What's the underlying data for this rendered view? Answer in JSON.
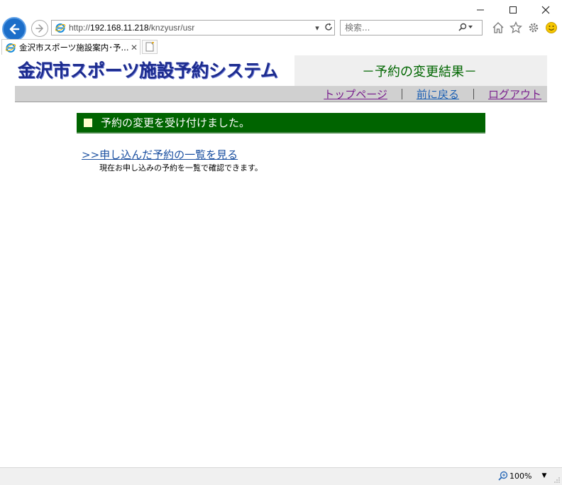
{
  "browser": {
    "address": {
      "prefix": "http://",
      "host": "192.168.11.218",
      "path": "/knzyusr/usr"
    },
    "search": {
      "placeholder": "検索..."
    },
    "tab": {
      "title": "金沢市スポーツ施設案内･予..."
    },
    "zoom": "100%",
    "accent": "#1c6ec9"
  },
  "page": {
    "logo_text": "金沢市スポーツ施設予約システム",
    "title": "－予約の変更結果－",
    "nav": {
      "top": "トップページ",
      "back": "前に戻る",
      "logout": "ログアウト",
      "separator": "｜"
    },
    "message": "予約の変更を受け付けました。",
    "list_link": ">>申し込んだ予約の一覧を見る",
    "list_desc": "現在お申し込みの予約を一覧で確認できます。",
    "colors": {
      "message_bar": "#006400",
      "title_text": "#006600",
      "logo_text": "#1d2c8e"
    }
  }
}
